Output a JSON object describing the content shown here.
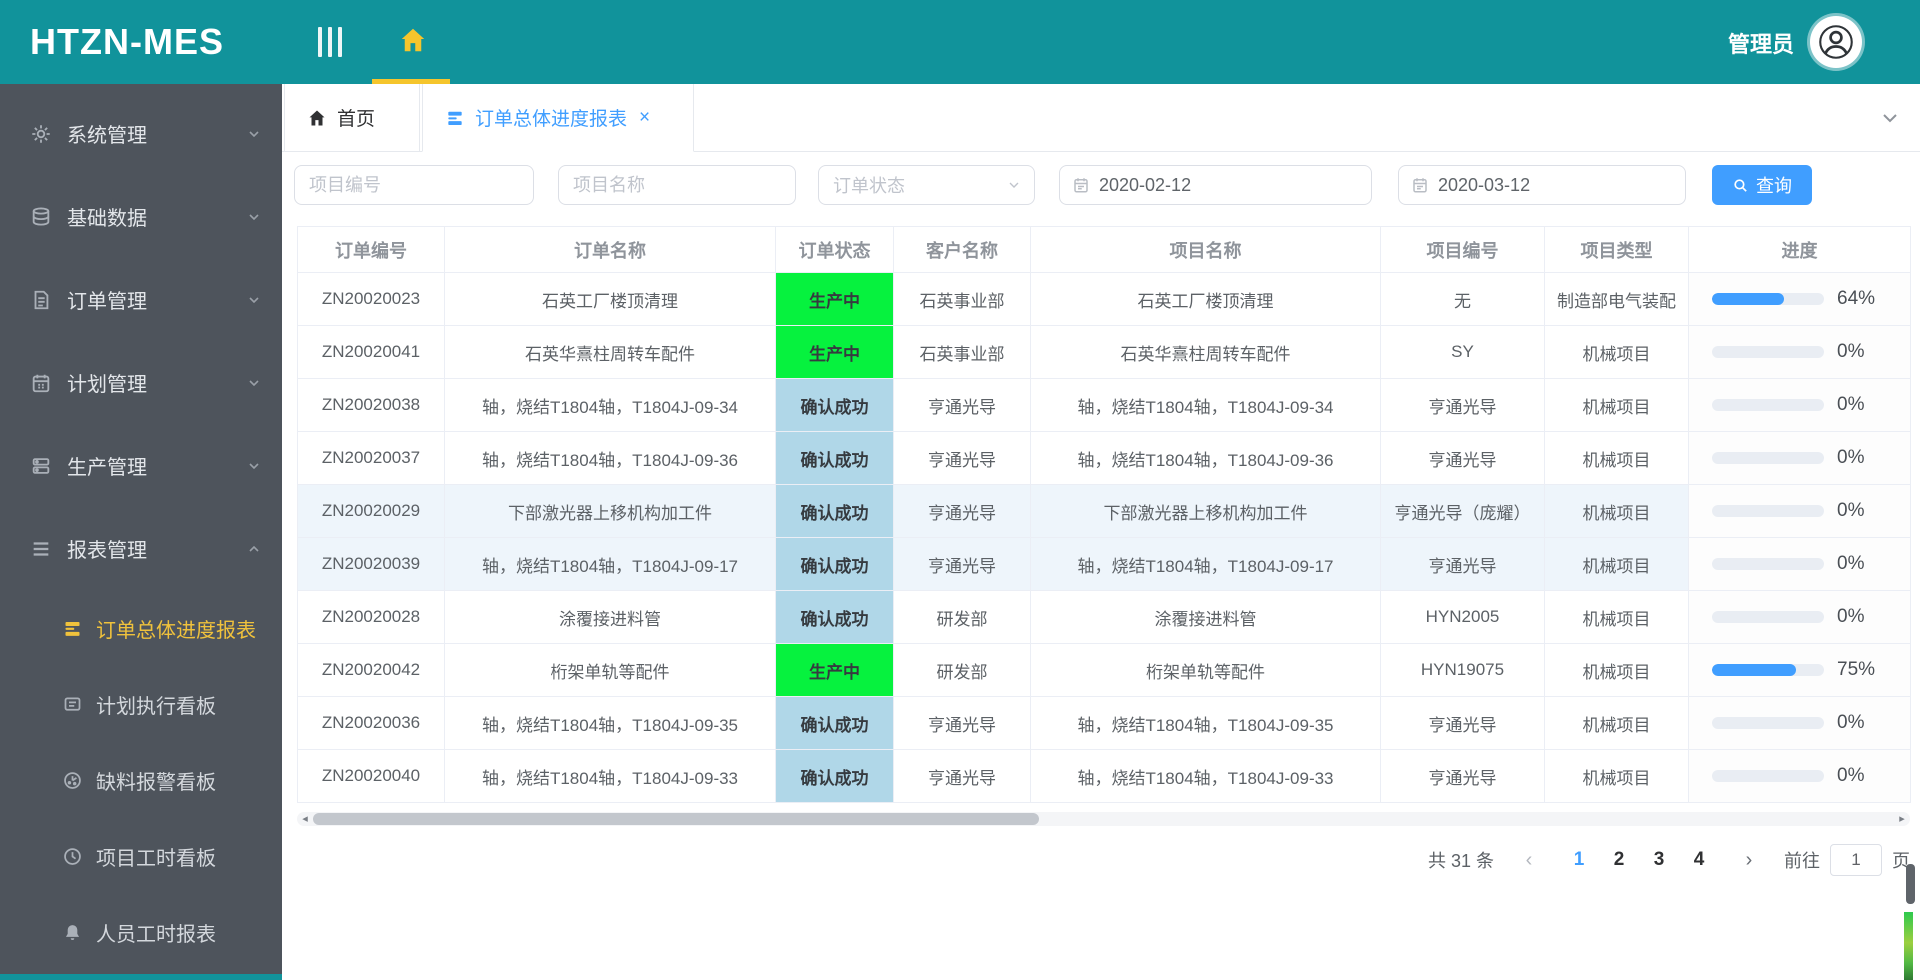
{
  "app": {
    "logo": "HTZN-MES",
    "user_label": "管理员"
  },
  "sidebar": {
    "items": [
      {
        "label": "系统管理"
      },
      {
        "label": "基础数据"
      },
      {
        "label": "订单管理"
      },
      {
        "label": "计划管理"
      },
      {
        "label": "生产管理"
      },
      {
        "label": "报表管理"
      }
    ],
    "report_children": [
      {
        "label": "订单总体进度报表"
      },
      {
        "label": "计划执行看板"
      },
      {
        "label": "缺料报警看板"
      },
      {
        "label": "项目工时看板"
      },
      {
        "label": "人员工时报表"
      }
    ]
  },
  "tabs": {
    "home": "首页",
    "report": "订单总体进度报表",
    "close": "×"
  },
  "filters": {
    "project_no_placeholder": "项目编号",
    "project_name_placeholder": "项目名称",
    "order_status_placeholder": "订单状态",
    "date_start": "2020-02-12",
    "date_end": "2020-03-12",
    "search_label": "查询"
  },
  "table": {
    "headers": [
      "订单编号",
      "订单名称",
      "订单状态",
      "客户名称",
      "项目名称",
      "项目编号",
      "项目类型",
      "进度"
    ],
    "rows": [
      {
        "order_no": "ZN20020023",
        "order_name": "石英工厂楼顶清理",
        "status": "生产中",
        "status_class": "st-green",
        "customer": "石英事业部",
        "project_name": "石英工厂楼顶清理",
        "project_no": "无",
        "project_type": "制造部电气装配",
        "progress": 64,
        "progress_label": "64%"
      },
      {
        "order_no": "ZN20020041",
        "order_name": "石英华熹柱周转车配件",
        "status": "生产中",
        "status_class": "st-green",
        "customer": "石英事业部",
        "project_name": "石英华熹柱周转车配件",
        "project_no": "SY",
        "project_type": "机械项目",
        "progress": 0,
        "progress_label": "0%"
      },
      {
        "order_no": "ZN20020038",
        "order_name": "轴，烧结T1804轴，T1804J-09-34",
        "status": "确认成功",
        "status_class": "st-blue",
        "customer": "亨通光导",
        "project_name": "轴，烧结T1804轴，T1804J-09-34",
        "project_no": "亨通光导",
        "project_type": "机械项目",
        "progress": 0,
        "progress_label": "0%"
      },
      {
        "order_no": "ZN20020037",
        "order_name": "轴，烧结T1804轴，T1804J-09-36",
        "status": "确认成功",
        "status_class": "st-blue",
        "customer": "亨通光导",
        "project_name": "轴，烧结T1804轴，T1804J-09-36",
        "project_no": "亨通光导",
        "project_type": "机械项目",
        "progress": 0,
        "progress_label": "0%"
      },
      {
        "order_no": "ZN20020029",
        "order_name": "下部激光器上移机构加工件",
        "status": "确认成功",
        "status_class": "st-blue",
        "customer": "亨通光导",
        "project_name": "下部激光器上移机构加工件",
        "project_no": "亨通光导（庞耀）",
        "project_type": "机械项目",
        "progress": 0,
        "progress_label": "0%"
      },
      {
        "order_no": "ZN20020039",
        "order_name": "轴，烧结T1804轴，T1804J-09-17",
        "status": "确认成功",
        "status_class": "st-blue",
        "customer": "亨通光导",
        "project_name": "轴，烧结T1804轴，T1804J-09-17",
        "project_no": "亨通光导",
        "project_type": "机械项目",
        "progress": 0,
        "progress_label": "0%"
      },
      {
        "order_no": "ZN20020028",
        "order_name": "涂覆接进料管",
        "status": "确认成功",
        "status_class": "st-blue",
        "customer": "研发部",
        "project_name": "涂覆接进料管",
        "project_no": "HYN2005",
        "project_type": "机械项目",
        "progress": 0,
        "progress_label": "0%"
      },
      {
        "order_no": "ZN20020042",
        "order_name": "桁架单轨等配件",
        "status": "生产中",
        "status_class": "st-green",
        "customer": "研发部",
        "project_name": "桁架单轨等配件",
        "project_no": "HYN19075",
        "project_type": "机械项目",
        "progress": 75,
        "progress_label": "75%"
      },
      {
        "order_no": "ZN20020036",
        "order_name": "轴，烧结T1804轴，T1804J-09-35",
        "status": "确认成功",
        "status_class": "st-blue",
        "customer": "亨通光导",
        "project_name": "轴，烧结T1804轴，T1804J-09-35",
        "project_no": "亨通光导",
        "project_type": "机械项目",
        "progress": 0,
        "progress_label": "0%"
      },
      {
        "order_no": "ZN20020040",
        "order_name": "轴，烧结T1804轴，T1804J-09-33",
        "status": "确认成功",
        "status_class": "st-blue",
        "customer": "亨通光导",
        "project_name": "轴，烧结T1804轴，T1804J-09-33",
        "project_no": "亨通光导",
        "project_type": "机械项目",
        "progress": 0,
        "progress_label": "0%"
      }
    ]
  },
  "pagination": {
    "total": "共 31 条",
    "prev": "‹",
    "next": "›",
    "pages": [
      "1",
      "2",
      "3",
      "4"
    ],
    "active_page": "1",
    "goto_prefix": "前往",
    "goto_value": "1",
    "goto_suffix": "页"
  },
  "colors": {
    "header_teal": "#11939b",
    "sidebar_gray": "#4e545c",
    "accent_blue": "#409eff",
    "active_yellow": "#f0c23c",
    "status_producing_green": "#06f23e",
    "status_confirmed_blue": "#b0d7e8"
  }
}
